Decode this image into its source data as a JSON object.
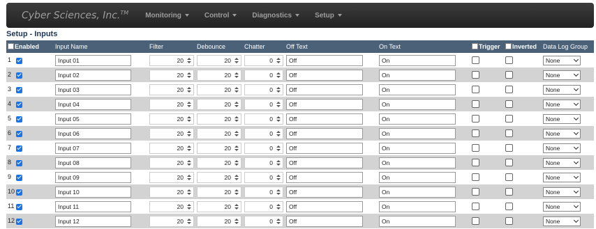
{
  "brand": {
    "name": "Cyber Sciences, Inc.",
    "tm": "TM"
  },
  "nav": [
    {
      "label": "Monitoring"
    },
    {
      "label": "Control"
    },
    {
      "label": "Diagnostics"
    },
    {
      "label": "Setup"
    }
  ],
  "page_title": "Setup - Inputs",
  "columns": {
    "enabled": "Enabled",
    "input_name": "Input Name",
    "filter": "Filter",
    "debounce": "Debounce",
    "chatter": "Chatter",
    "off_text": "Off Text",
    "on_text": "On Text",
    "trigger": "Trigger",
    "inverted": "Inverted",
    "data_log_group": "Data Log Group"
  },
  "rows": [
    {
      "num": "1",
      "enabled": true,
      "name": "Input 01",
      "filter": "20",
      "debounce": "20",
      "chatter": "0",
      "off": "Off",
      "on": "On",
      "trigger": false,
      "inverted": false,
      "group": "None"
    },
    {
      "num": "2",
      "enabled": true,
      "name": "Input 02",
      "filter": "20",
      "debounce": "20",
      "chatter": "0",
      "off": "Off",
      "on": "On",
      "trigger": false,
      "inverted": false,
      "group": "None"
    },
    {
      "num": "3",
      "enabled": true,
      "name": "Input 03",
      "filter": "20",
      "debounce": "20",
      "chatter": "0",
      "off": "Off",
      "on": "On",
      "trigger": false,
      "inverted": false,
      "group": "None"
    },
    {
      "num": "4",
      "enabled": true,
      "name": "Input 04",
      "filter": "20",
      "debounce": "20",
      "chatter": "0",
      "off": "Off",
      "on": "On",
      "trigger": false,
      "inverted": false,
      "group": "None"
    },
    {
      "num": "5",
      "enabled": true,
      "name": "Input 05",
      "filter": "20",
      "debounce": "20",
      "chatter": "0",
      "off": "Off",
      "on": "On",
      "trigger": false,
      "inverted": false,
      "group": "None"
    },
    {
      "num": "6",
      "enabled": true,
      "name": "Input 06",
      "filter": "20",
      "debounce": "20",
      "chatter": "0",
      "off": "Off",
      "on": "On",
      "trigger": false,
      "inverted": false,
      "group": "None"
    },
    {
      "num": "7",
      "enabled": true,
      "name": "Input 07",
      "filter": "20",
      "debounce": "20",
      "chatter": "0",
      "off": "Off",
      "on": "On",
      "trigger": false,
      "inverted": false,
      "group": "None"
    },
    {
      "num": "8",
      "enabled": true,
      "name": "Input 08",
      "filter": "20",
      "debounce": "20",
      "chatter": "0",
      "off": "Off",
      "on": "On",
      "trigger": false,
      "inverted": false,
      "group": "None"
    },
    {
      "num": "9",
      "enabled": true,
      "name": "Input 09",
      "filter": "20",
      "debounce": "20",
      "chatter": "0",
      "off": "Off",
      "on": "On",
      "trigger": false,
      "inverted": false,
      "group": "None"
    },
    {
      "num": "10",
      "enabled": true,
      "name": "Input 10",
      "filter": "20",
      "debounce": "20",
      "chatter": "0",
      "off": "Off",
      "on": "On",
      "trigger": false,
      "inverted": false,
      "group": "None"
    },
    {
      "num": "11",
      "enabled": true,
      "name": "Input 11",
      "filter": "20",
      "debounce": "20",
      "chatter": "0",
      "off": "Off",
      "on": "On",
      "trigger": false,
      "inverted": false,
      "group": "None"
    },
    {
      "num": "12",
      "enabled": true,
      "name": "Input 12",
      "filter": "20",
      "debounce": "20",
      "chatter": "0",
      "off": "Off",
      "on": "On",
      "trigger": false,
      "inverted": false,
      "group": "None"
    }
  ]
}
